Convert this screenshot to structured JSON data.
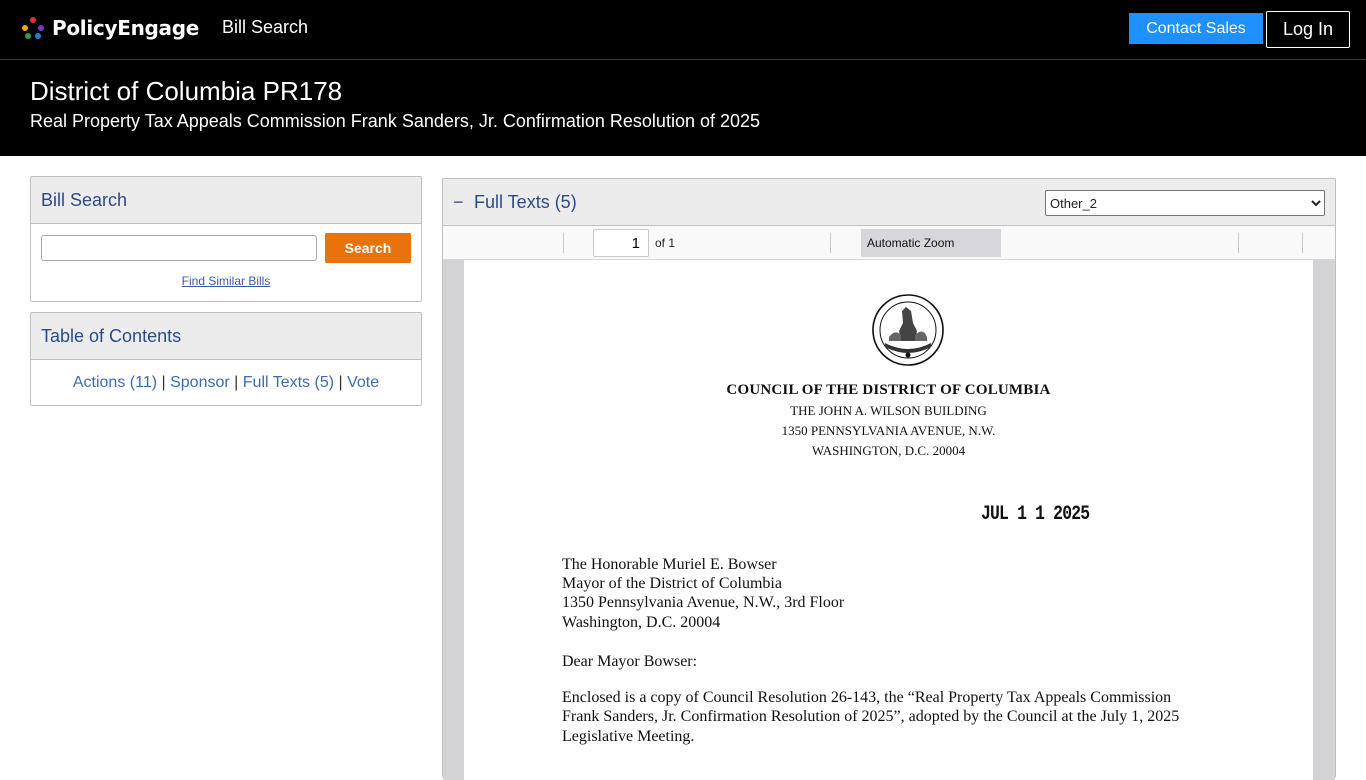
{
  "nav": {
    "brand": "PolicyEngage",
    "bill_search": "Bill Search",
    "contact_sales": "Contact Sales",
    "login": "Log In"
  },
  "header": {
    "title": "District of Columbia PR178",
    "subtitle": "Real Property Tax Appeals Commission Frank Sanders, Jr. Confirmation Resolution of 2025"
  },
  "bill_search": {
    "title": "Bill Search",
    "input_value": "",
    "search_button": "Search",
    "similar_link": "Find Similar Bills"
  },
  "toc": {
    "title": "Table of Contents",
    "links": [
      "Actions (11)",
      "Sponsor",
      "Full Texts (5)",
      "Vote"
    ],
    "separator": "|"
  },
  "full_texts": {
    "toggle": "−",
    "title": "Full Texts (5)",
    "selected_option": "Other_2"
  },
  "pdf_toolbar": {
    "page_number": "1",
    "page_count": "of 1",
    "zoom": "Automatic Zoom"
  },
  "document": {
    "council": "COUNCIL OF THE DISTRICT OF COLUMBIA",
    "address_lines": [
      "THE JOHN A. WILSON BUILDING",
      "1350 PENNSYLVANIA AVENUE, N.W.",
      "WASHINGTON, D.C. 20004"
    ],
    "date_stamp": "JUL 1 1 2025",
    "recipient_lines": [
      "The Honorable Muriel E. Bowser",
      "Mayor of the District of Columbia",
      "1350 Pennsylvania Avenue, N.W., 3rd Floor",
      "Washington, D.C.  20004"
    ],
    "salutation": "Dear Mayor Bowser:",
    "body_lines": [
      "Enclosed is a copy of Council Resolution 26-143, the “Real Property Tax Appeals Commission",
      "Frank Sanders, Jr. Confirmation Resolution of 2025”, adopted by the Council at the July 1, 2025",
      "Legislative Meeting."
    ]
  },
  "colors": {
    "accent_blue": "#1e90ff",
    "search_orange": "#e8730c",
    "panel_title": "#2c4a8a",
    "link_blue": "#3d6bb3"
  }
}
